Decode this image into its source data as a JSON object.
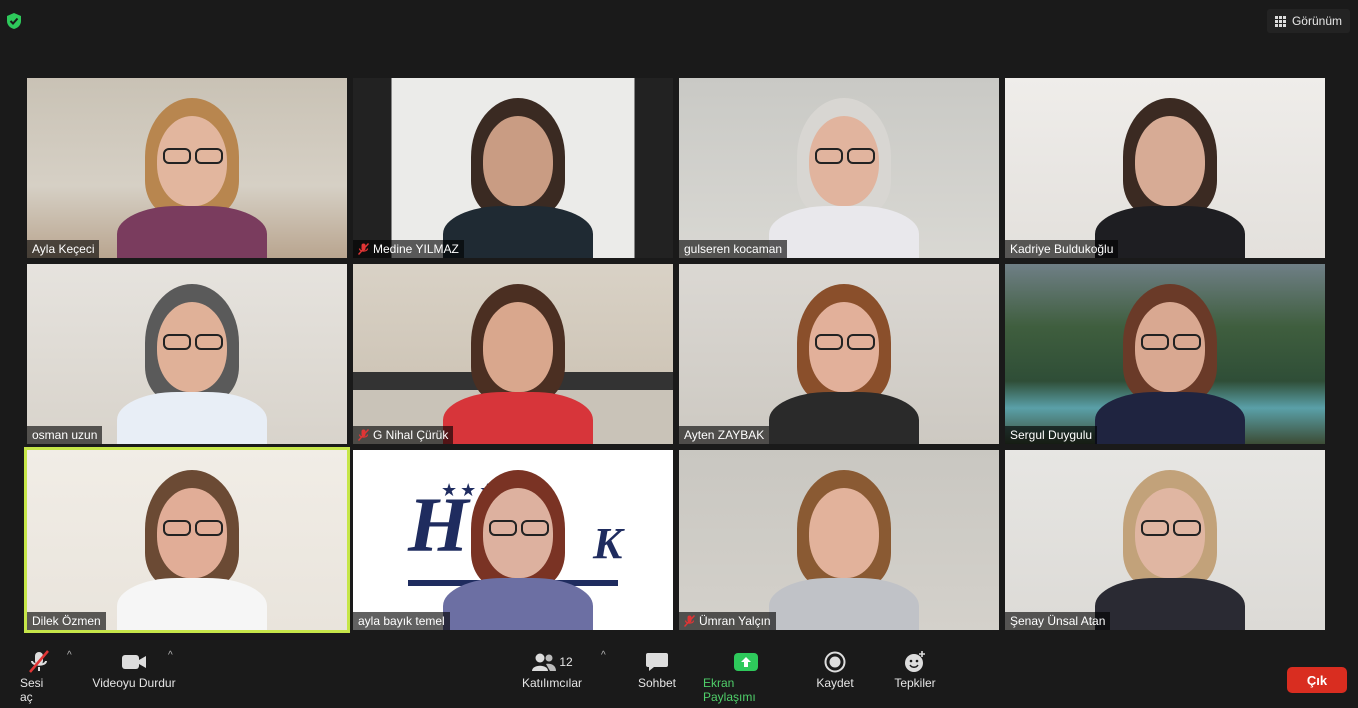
{
  "topbar": {
    "view_label": "Görünüm"
  },
  "colors": {
    "active_speaker": "#c6e649",
    "share_green": "#2ec95b",
    "leave_red": "#d92d20"
  },
  "participants": [
    {
      "name": "Ayla Keçeci",
      "muted": false
    },
    {
      "name": "Medine YILMAZ",
      "muted": true
    },
    {
      "name": "gulseren kocaman",
      "muted": false
    },
    {
      "name": "Kadriye Buldukoğlu",
      "muted": false
    },
    {
      "name": "osman uzun",
      "muted": false
    },
    {
      "name": "G Nihal Çürük",
      "muted": true
    },
    {
      "name": "Ayten ZAYBAK",
      "muted": false
    },
    {
      "name": "Sergul Duygulu",
      "muted": false
    },
    {
      "name": "Dilek Özmen",
      "muted": false,
      "active_speaker": true
    },
    {
      "name": "ayla bayık temel",
      "muted": false
    },
    {
      "name": "Ümran Yalçın",
      "muted": true
    },
    {
      "name": "Şenay Ünsal Atan",
      "muted": false
    }
  ],
  "toolbar": {
    "audio_label": "Sesi aç",
    "video_label": "Videoyu Durdur",
    "participants_label": "Katılımcılar",
    "participants_count": "12",
    "chat_label": "Sohbet",
    "share_label": "Ekran Paylaşımı",
    "record_label": "Kaydet",
    "reactions_label": "Tepkiler",
    "leave_label": "Çık"
  }
}
